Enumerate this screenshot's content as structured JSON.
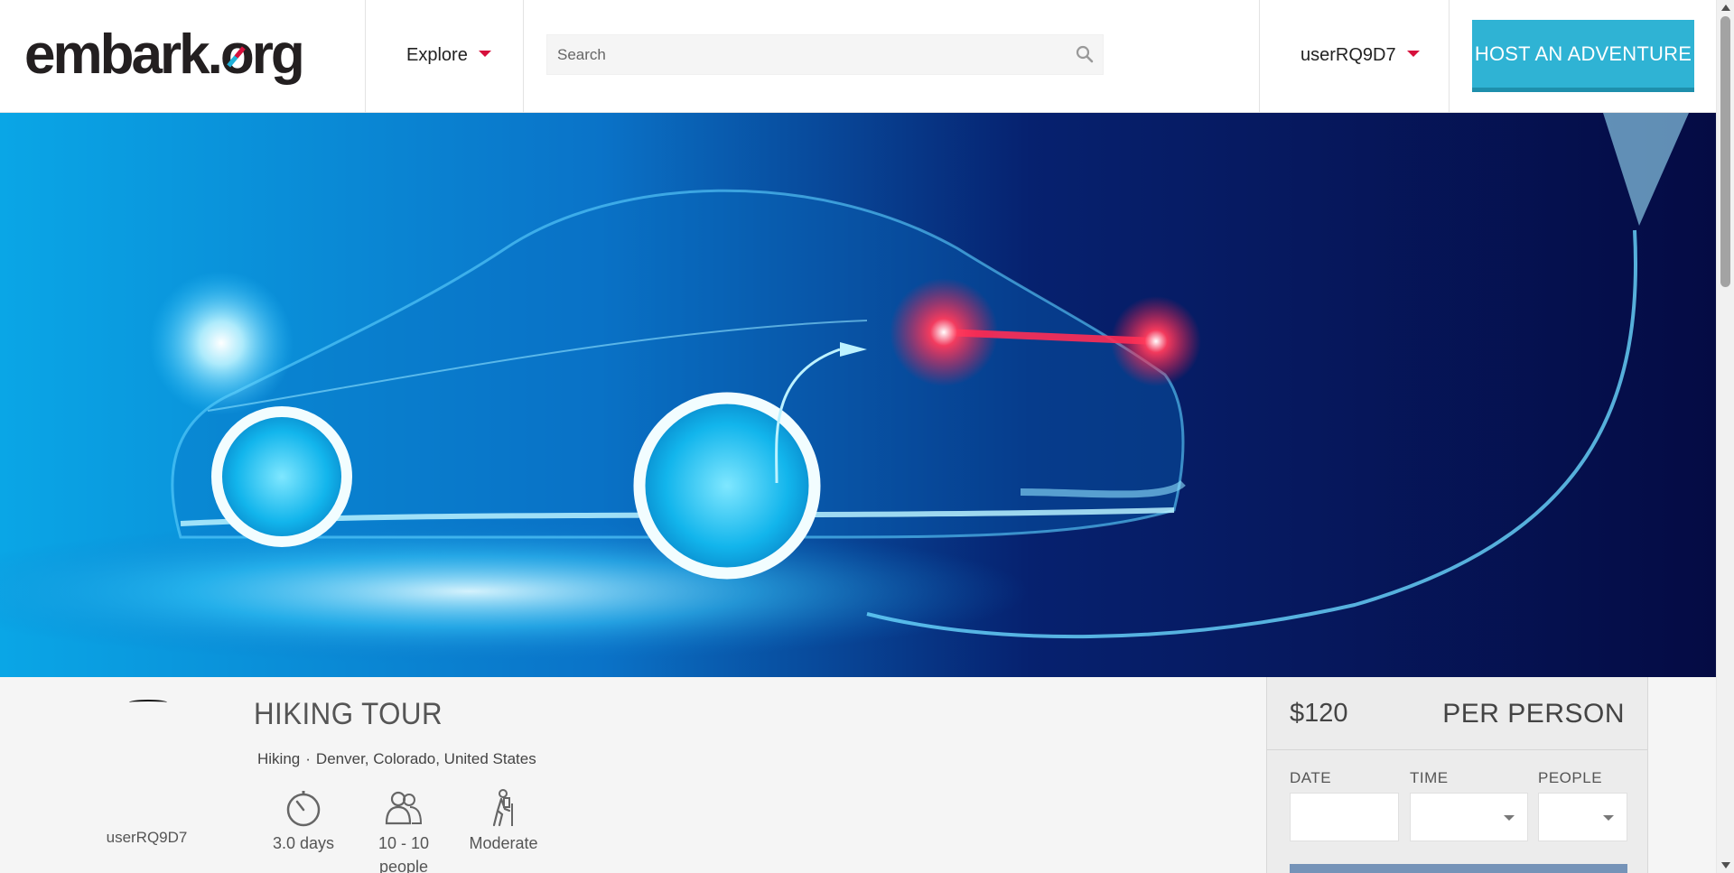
{
  "header": {
    "logo_text": "embark.org",
    "explore_label": "Explore",
    "search_placeholder": "Search",
    "username": "userRQ9D7",
    "host_button_label": "HOST AN ADVENTURE"
  },
  "listing": {
    "title": "HIKING TOUR",
    "category": "Hiking",
    "separator": "·",
    "location": "Denver, Colorado, United States",
    "host_name": "userRQ9D7",
    "stats": [
      {
        "icon": "stopwatch-icon",
        "label": "3.0 days"
      },
      {
        "icon": "people-icon",
        "label": "10 - 10 people"
      },
      {
        "icon": "hiker-icon",
        "label": "Moderate"
      }
    ]
  },
  "booking": {
    "price": "$120",
    "price_unit": "PER PERSON",
    "date_label": "DATE",
    "time_label": "TIME",
    "people_label": "PEOPLE"
  },
  "colors": {
    "accent_red": "#d6103c",
    "host_button": "#2fb3d4",
    "book_button": "#7593b8"
  }
}
